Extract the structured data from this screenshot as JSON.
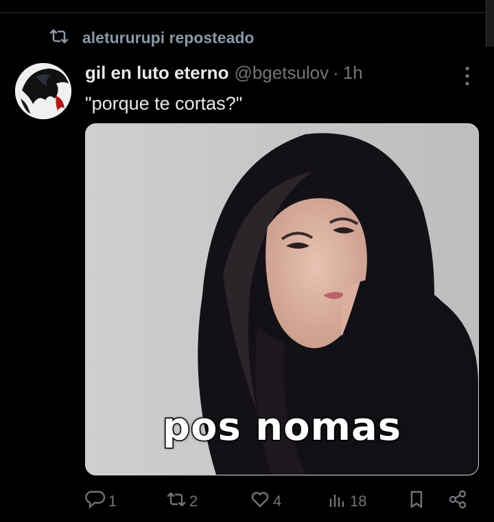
{
  "repost": {
    "icon": "repost-icon",
    "label": "aletururupi reposteado"
  },
  "tweet": {
    "author_name": "gil en luto eterno",
    "handle": "@bgetsulov",
    "separator": "·",
    "time": "1h",
    "text": "\"porque te cortas?\"",
    "media": {
      "caption": "pos nomas",
      "description_icon": "photo-of-girl"
    }
  },
  "actions": {
    "replies": "1",
    "reposts": "2",
    "likes": "4",
    "views": "18"
  },
  "colors": {
    "background": "#000000",
    "text": "#e7e9ea",
    "muted": "#71767b"
  }
}
